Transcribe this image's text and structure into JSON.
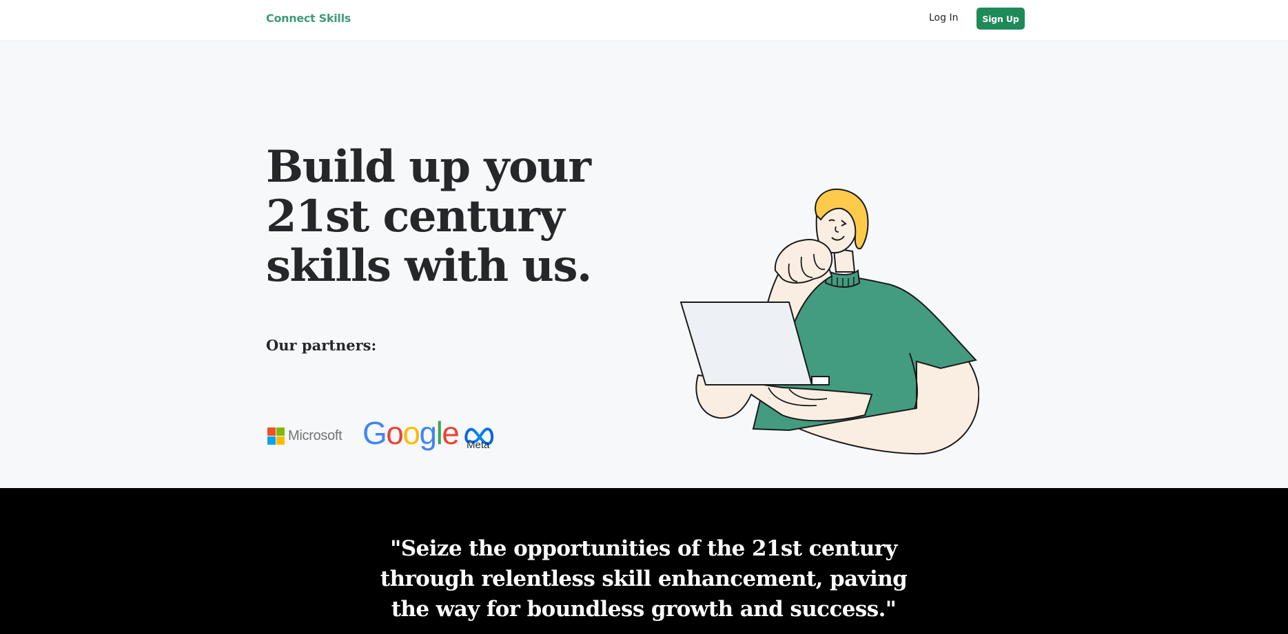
{
  "nav": {
    "brand": "Connect Skills",
    "login_label": "Log In",
    "signup_label": "Sign Up"
  },
  "hero": {
    "headline": "Build up your 21st century skills with us.",
    "partners_label": "Our partners:",
    "partners": {
      "microsoft": "Microsoft",
      "google": "Google",
      "meta": "Meta"
    }
  },
  "quote": {
    "text": "\"Seize the opportunities of the 21st century through relentless skill enhancement, paving the way for boundless growth and success.\""
  },
  "colors": {
    "brand": "#3f9b78",
    "signup_bg": "#1f8a59",
    "hero_bg": "#f7f8fa",
    "quote_bg": "#000000",
    "shirt": "#439c7f",
    "hair": "#fdca4c",
    "skin": "#faeee2"
  }
}
